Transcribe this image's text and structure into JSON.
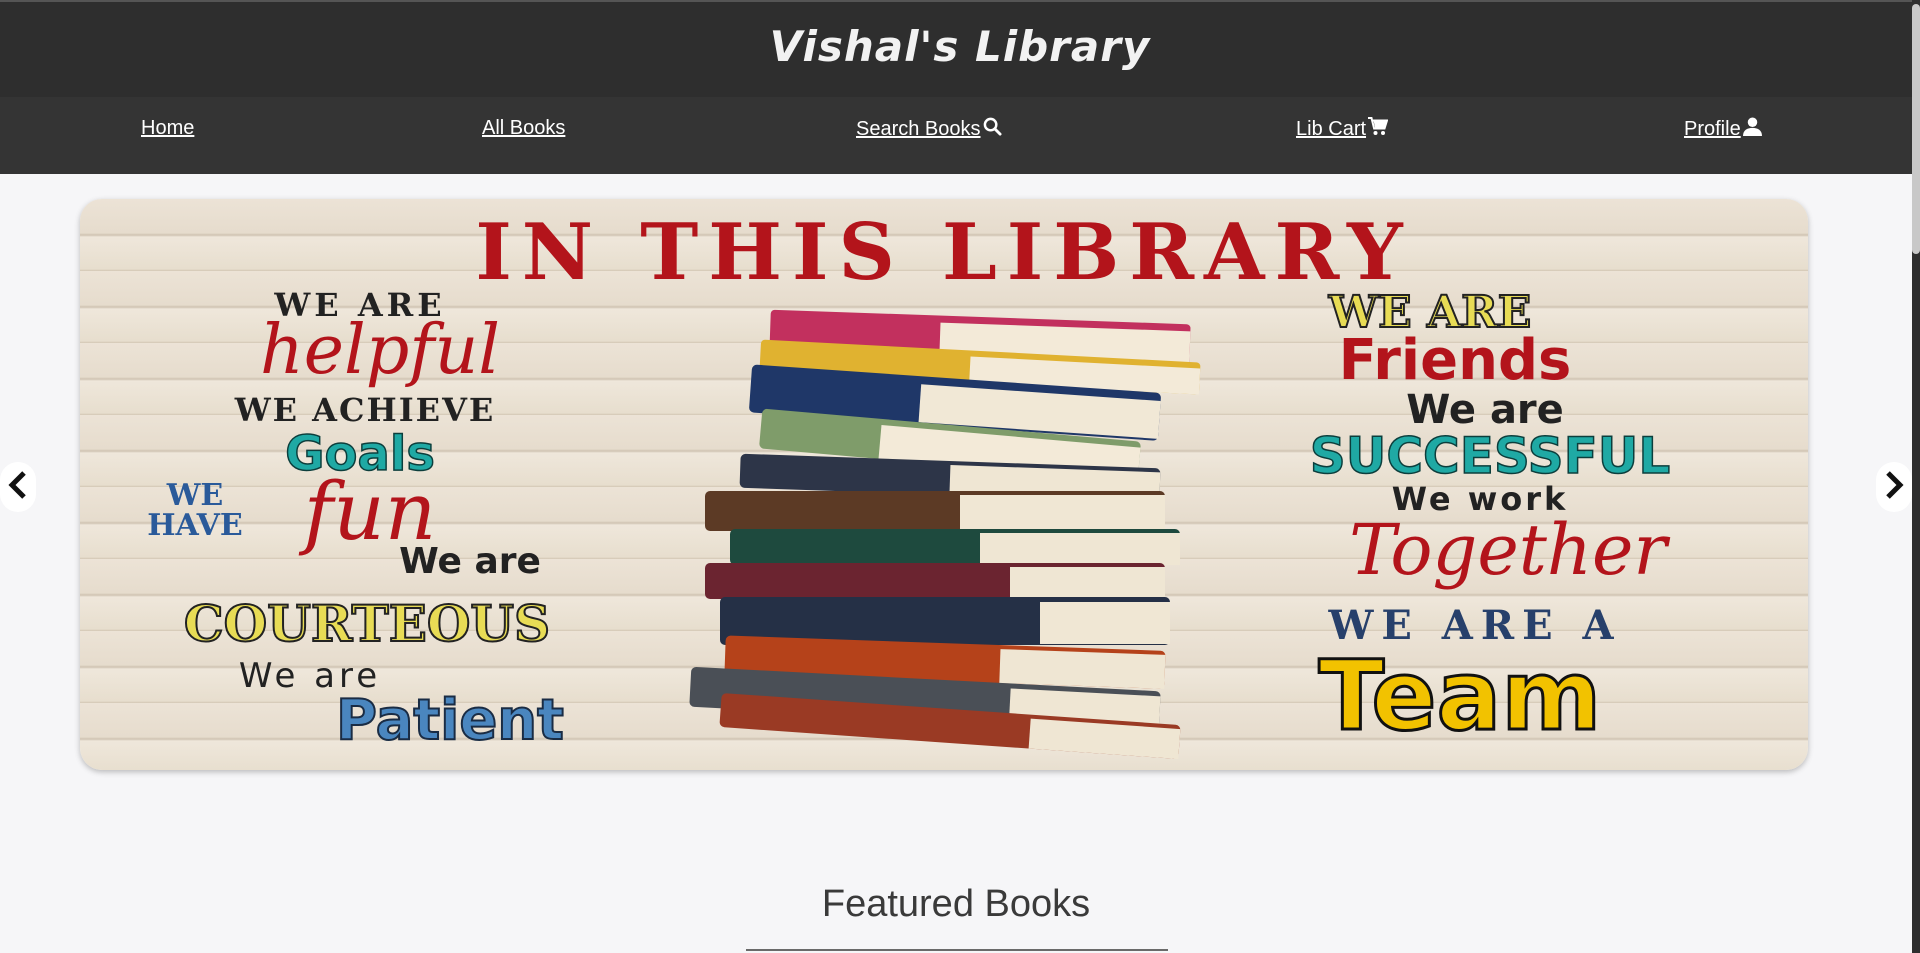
{
  "header": {
    "site_title": "Vishal's Library"
  },
  "nav": {
    "items": [
      {
        "label": "Home",
        "icon": ""
      },
      {
        "label": "All Books",
        "icon": ""
      },
      {
        "label": "Search Books",
        "icon": "search-icon"
      },
      {
        "label": "Lib Cart ",
        "icon": "cart-icon"
      },
      {
        "label": "Profile ",
        "icon": "user-icon"
      }
    ]
  },
  "carousel": {
    "banner": {
      "headline": "IN THIS LIBRARY",
      "left_lines": [
        "WE ARE",
        "helpful",
        "WE ACHIEVE",
        "Goals",
        "WE",
        "HAVE",
        "fun",
        "We are",
        "COURTEOUS",
        "We are",
        "Patient"
      ],
      "right_lines": [
        "WE ARE",
        "Friends",
        "We are",
        "SUCCESSFUL",
        "We work",
        "Together",
        "WE ARE A",
        "Team"
      ]
    },
    "prev_icon": "chevron-left-icon",
    "next_icon": "chevron-right-icon"
  },
  "featured": {
    "heading": "Featured Books"
  },
  "colors": {
    "header_bg": "#2e2e2e",
    "nav_bg": "#343434",
    "page_bg": "#f6f6f8",
    "banner_red": "#b3141b",
    "banner_teal": "#1fa9a4",
    "banner_yellow": "#f2d500",
    "banner_navy": "#27406b"
  }
}
